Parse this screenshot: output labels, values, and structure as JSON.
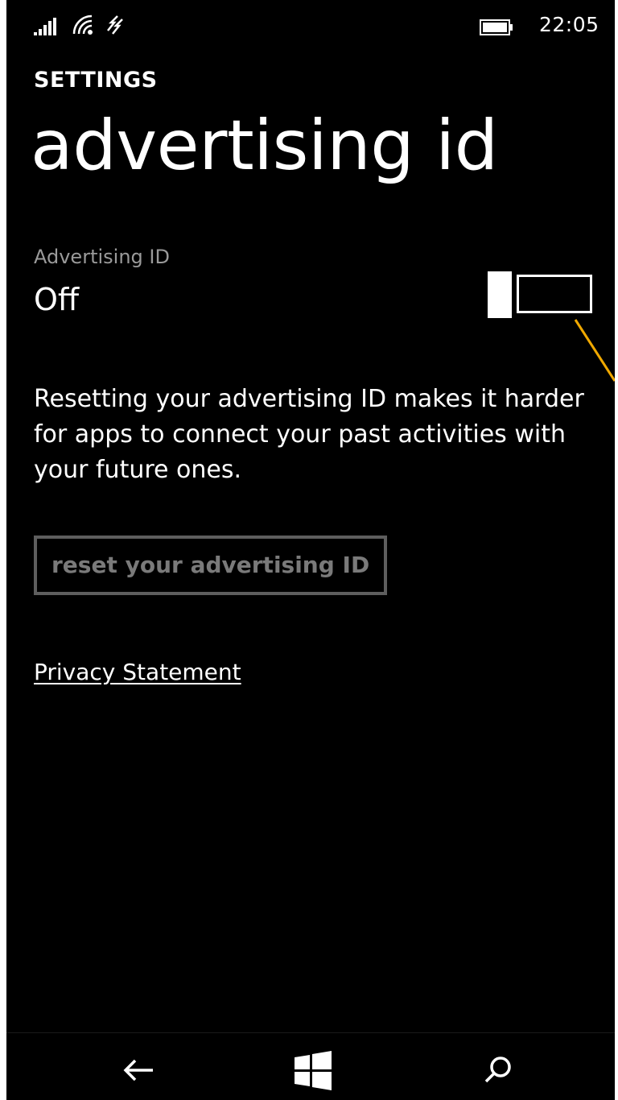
{
  "status_bar": {
    "time": "22:05",
    "icons": [
      "signal-strength-icon",
      "wifi-icon",
      "data-connection-icon",
      "battery-icon"
    ]
  },
  "header": {
    "app_title": "SETTINGS",
    "page_title": "advertising id"
  },
  "setting": {
    "label": "Advertising ID",
    "value": "Off",
    "toggle_on": false
  },
  "description": "Resetting your advertising ID makes it harder for apps to connect your past activities with your future ones.",
  "reset_button": {
    "label": "reset your advertising ID",
    "enabled": false
  },
  "privacy_link": {
    "label": "Privacy Statement"
  },
  "nav_bar": {
    "buttons": [
      "back-arrow-icon",
      "windows-start-icon",
      "search-icon"
    ]
  },
  "colors": {
    "background": "#000000",
    "foreground": "#ffffff",
    "secondary_text": "#9a9a9a",
    "disabled": "#5e5e5e",
    "annotation": "#f0a800"
  }
}
